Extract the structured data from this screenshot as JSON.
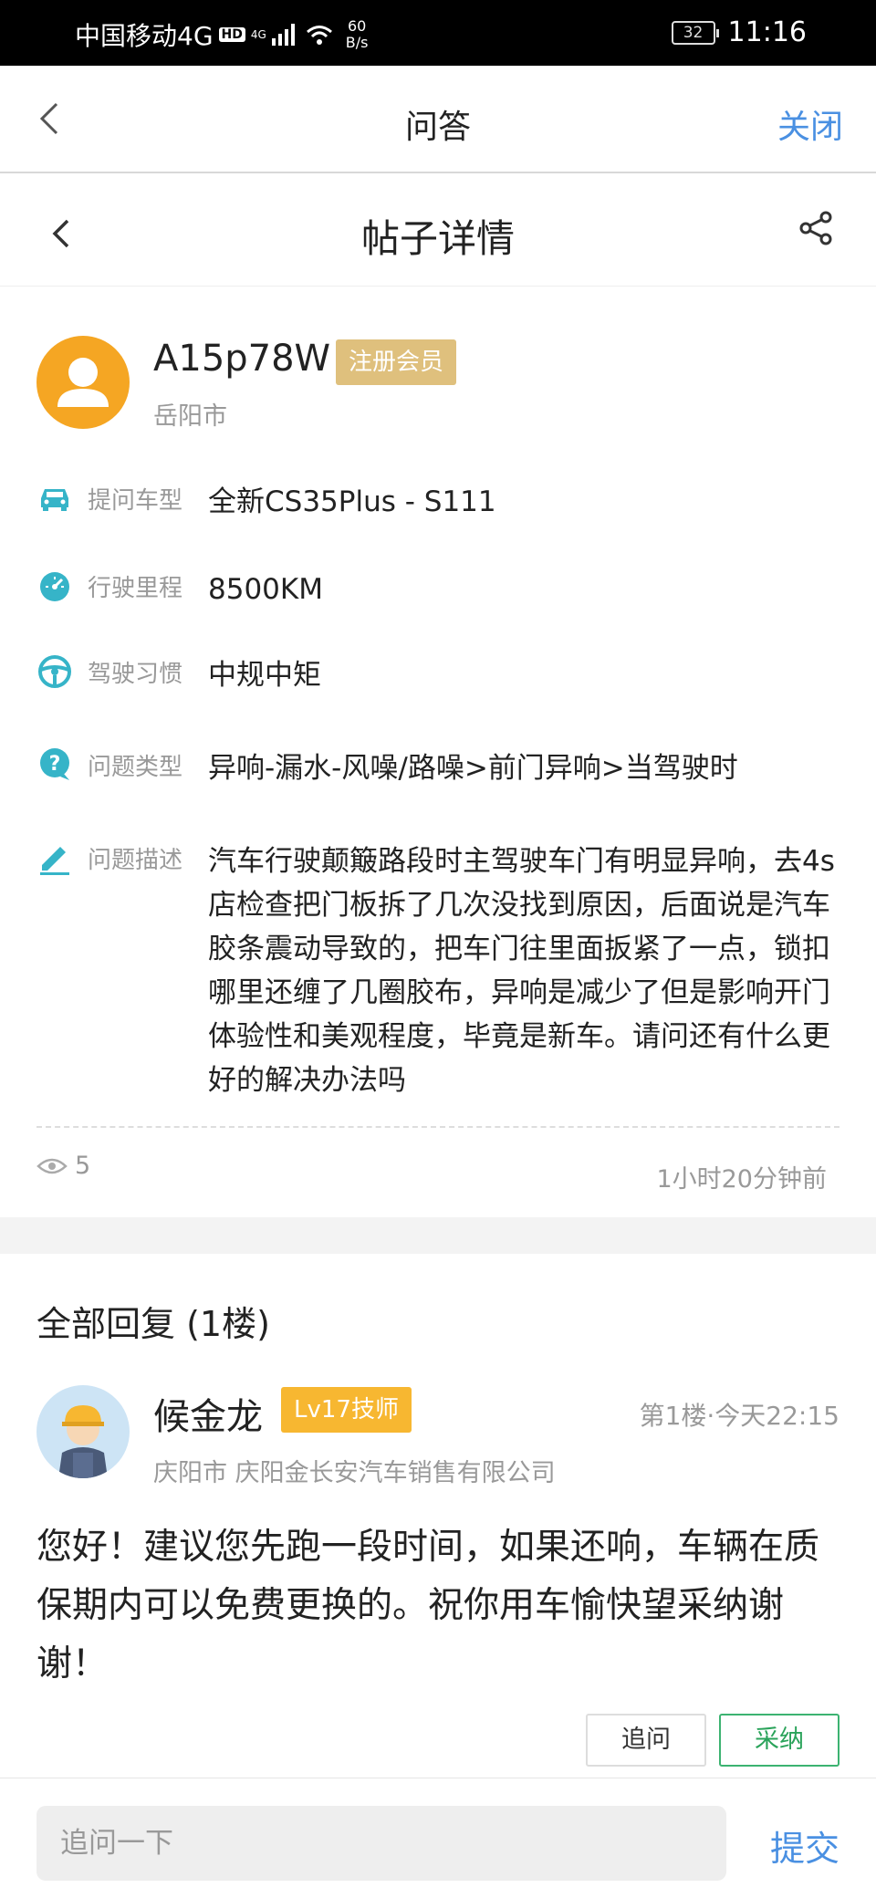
{
  "status_bar": {
    "carrier": "中国移动4G",
    "hd": "HD",
    "signal_label": "4G",
    "speed_value": "60",
    "speed_unit": "B/s",
    "battery": "32",
    "time": "11:16"
  },
  "webview_header": {
    "title": "问答",
    "close_label": "关闭"
  },
  "page_header": {
    "title": "帖子详情"
  },
  "post": {
    "author": {
      "name": "A15p78W",
      "badge": "注册会员",
      "city": "岳阳市"
    },
    "fields": [
      {
        "icon": "car-icon",
        "label": "提问车型",
        "value": "全新CS35Plus - S111"
      },
      {
        "icon": "speedometer-icon",
        "label": "行驶里程",
        "value": "8500KM"
      },
      {
        "icon": "steering-wheel-icon",
        "label": "驾驶习惯",
        "value": "中规中矩"
      },
      {
        "icon": "question-icon",
        "label": "问题类型",
        "value": "异响-漏水-风噪/路噪>前门异响>当驾驶时"
      },
      {
        "icon": "pencil-icon",
        "label": "问题描述",
        "value": "汽车行驶颠簸路段时主驾驶车门有明显异响，去4s店检查把门板拆了几次没找到原因，后面说是汽车胶条震动导致的，把车门往里面扳紧了一点，锁扣哪里还缠了几圈胶布，异响是减少了但是影响开门体验性和美观程度，毕竟是新车。请问还有什么更好的解决办法吗"
      }
    ],
    "views": "5",
    "time": "1小时20分钟前"
  },
  "replies": {
    "heading": "全部回复 (1楼)",
    "items": [
      {
        "name": "候金龙",
        "badge": "Lv17技师",
        "floor": "第1楼·今天22:15",
        "meta": "庆阳市  庆阳金长安汽车销售有限公司",
        "text": "您好！建议您先跑一段时间，如果还响，车辆在质保期内可以免费更换的。祝你用车愉快望采纳谢谢！",
        "follow_up_label": "追问",
        "accept_label": "采纳"
      }
    ]
  },
  "bottom_bar": {
    "input_placeholder": "追问一下",
    "submit_label": "提交"
  },
  "colors": {
    "link_blue": "#4a90e2",
    "icon_teal": "#36b4c8",
    "member_badge": "#dfc07d",
    "tech_badge": "#f7b731",
    "accept_green": "#3cb371"
  }
}
